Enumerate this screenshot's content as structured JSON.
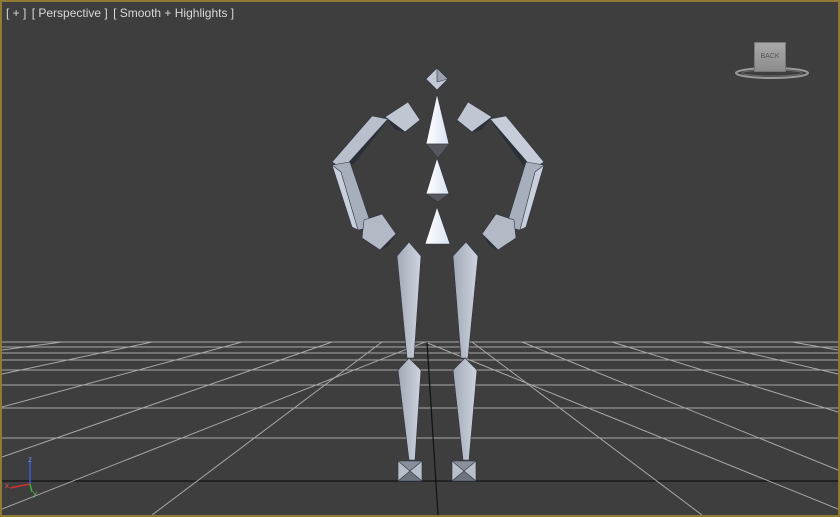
{
  "viewport": {
    "menu": {
      "plus": "[ + ]",
      "view": "[ Perspective ]",
      "shading": "[ Smooth + Highlights ]"
    },
    "active_border_color": "#8f7a36",
    "background_color": "#3e3e3e",
    "grid_color": "#a8a8a8",
    "viewcube_label": "BACK",
    "axis_labels": {
      "x": "x",
      "y": "y",
      "z": "z"
    }
  }
}
